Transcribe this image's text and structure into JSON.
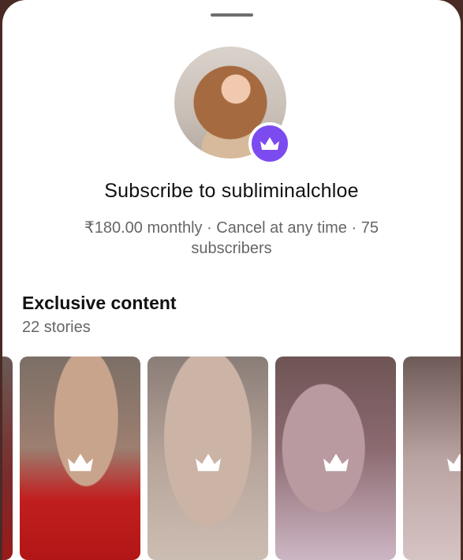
{
  "profile": {
    "title": "Subscribe to subliminalchloe",
    "meta": "₹180.00 monthly · Cancel at any time · 75 subscribers"
  },
  "exclusive": {
    "title": "Exclusive content",
    "subtitle": "22 stories"
  },
  "colors": {
    "accent": "#7b4bf0",
    "text_primary": "#111111",
    "text_secondary": "#666666"
  },
  "icons": {
    "badge": "crown-icon",
    "story_lock": "crown-icon"
  }
}
